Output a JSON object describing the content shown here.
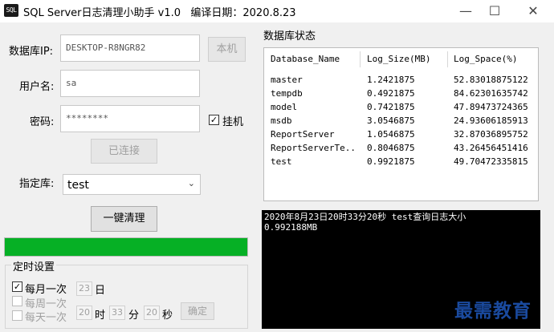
{
  "window": {
    "icon_text": "SQL",
    "title": "SQL Server日志清理小助手 v1.0   编译日期：2020.8.23",
    "minimize": "—",
    "maximize": "☐",
    "close": "✕"
  },
  "form": {
    "server_label": "数据库IP:",
    "server_value": "DESKTOP-R8NGR82",
    "local_button": "本机",
    "user_label": "用户名:",
    "user_value": "sa",
    "password_label": "密码:",
    "password_value": "********",
    "hang_checkbox_mark": "✓",
    "hang_label": "挂机",
    "connect_button": "已连接",
    "database_label": "指定库:",
    "database_value": "test",
    "combo_arrow": "⌄",
    "clean_button": "一键清理",
    "progress_fraction": 1.0
  },
  "schedule": {
    "group_title": "定时设置",
    "monthly_checked_mark": "✓",
    "monthly_label": "每月一次",
    "weekly_label": "每周一次",
    "daily_label": "每天一次",
    "day_value": "23",
    "day_unit": "日",
    "hour_value": "20",
    "hour_unit": "时",
    "minute_value": "33",
    "minute_unit": "分",
    "second_value": "20",
    "second_unit": "秒",
    "confirm_button": "确定"
  },
  "status": {
    "title": "数据库状态",
    "columns": [
      "Database_Name",
      "Log_Size(MB)",
      "Log_Space(%)"
    ],
    "rows": [
      [
        "master",
        "1.2421875",
        "52.83018875122"
      ],
      [
        "tempdb",
        "0.4921875",
        "84.62301635742"
      ],
      [
        "model",
        "0.7421875",
        "47.89473724365"
      ],
      [
        "msdb",
        "3.0546875",
        "24.93606185913"
      ],
      [
        "ReportServer",
        "1.0546875",
        "32.87036895752"
      ],
      [
        "ReportServerTe...",
        "0.8046875",
        "43.26456451416"
      ],
      [
        "test",
        "0.9921875",
        "49.70472335815"
      ]
    ]
  },
  "log": {
    "lines": [
      "2020年8月23日20时33分20秒   test查询日志大小",
      "0.992188MB"
    ]
  },
  "watermark": "最需教育",
  "colors": {
    "progress_fill": "#06b025",
    "log_background": "#000000",
    "log_text": "#ffffff",
    "watermark": "#1a4a9e"
  }
}
